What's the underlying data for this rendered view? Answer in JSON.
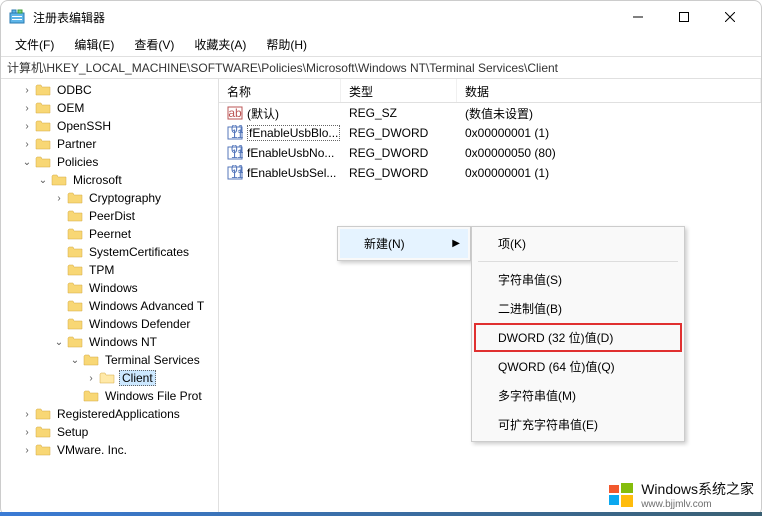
{
  "window": {
    "title": "注册表编辑器"
  },
  "menubar": {
    "items": [
      "文件(F)",
      "编辑(E)",
      "查看(V)",
      "收藏夹(A)",
      "帮助(H)"
    ]
  },
  "addressbar": {
    "path": "计算机\\HKEY_LOCAL_MACHINE\\SOFTWARE\\Policies\\Microsoft\\Windows NT\\Terminal Services\\Client"
  },
  "tree": {
    "items": [
      {
        "indent": 1,
        "expand": "right",
        "label": "ODBC"
      },
      {
        "indent": 1,
        "expand": "right",
        "label": "OEM"
      },
      {
        "indent": 1,
        "expand": "right",
        "label": "OpenSSH"
      },
      {
        "indent": 1,
        "expand": "right",
        "label": "Partner"
      },
      {
        "indent": 1,
        "expand": "down",
        "label": "Policies"
      },
      {
        "indent": 2,
        "expand": "down",
        "label": "Microsoft"
      },
      {
        "indent": 3,
        "expand": "right",
        "label": "Cryptography"
      },
      {
        "indent": 3,
        "expand": "none",
        "label": "PeerDist"
      },
      {
        "indent": 3,
        "expand": "none",
        "label": "Peernet"
      },
      {
        "indent": 3,
        "expand": "none",
        "label": "SystemCertificates"
      },
      {
        "indent": 3,
        "expand": "none",
        "label": "TPM"
      },
      {
        "indent": 3,
        "expand": "none",
        "label": "Windows"
      },
      {
        "indent": 3,
        "expand": "none",
        "label": "Windows Advanced T"
      },
      {
        "indent": 3,
        "expand": "none",
        "label": "Windows Defender"
      },
      {
        "indent": 3,
        "expand": "down",
        "label": "Windows NT"
      },
      {
        "indent": 4,
        "expand": "down",
        "label": "Terminal Services"
      },
      {
        "indent": 5,
        "expand": "right",
        "label": "Client",
        "selected": true
      },
      {
        "indent": 4,
        "expand": "none",
        "label": "Windows File Prot"
      },
      {
        "indent": 1,
        "expand": "right",
        "label": "RegisteredApplications"
      },
      {
        "indent": 1,
        "expand": "right",
        "label": "Setup"
      },
      {
        "indent": 1,
        "expand": "right",
        "label": "VMware. Inc."
      }
    ]
  },
  "list": {
    "columns": {
      "name": "名称",
      "type": "类型",
      "data": "数据"
    },
    "rows": [
      {
        "icon": "sz",
        "name": "(默认)",
        "type": "REG_SZ",
        "data": "(数值未设置)"
      },
      {
        "icon": "dw",
        "name": "fEnableUsbBlo...",
        "type": "REG_DWORD",
        "data": "0x00000001 (1)",
        "focused": true
      },
      {
        "icon": "dw",
        "name": "fEnableUsbNo...",
        "type": "REG_DWORD",
        "data": "0x00000050 (80)"
      },
      {
        "icon": "dw",
        "name": "fEnableUsbSel...",
        "type": "REG_DWORD",
        "data": "0x00000001 (1)"
      }
    ]
  },
  "context_main": {
    "items": [
      {
        "label": "新建(N)",
        "submenu": true
      }
    ]
  },
  "context_sub": {
    "items": [
      {
        "label": "项(K)"
      },
      {
        "sep": true
      },
      {
        "label": "字符串值(S)"
      },
      {
        "label": "二进制值(B)"
      },
      {
        "label": "DWORD (32 位)值(D)",
        "highlighted": true
      },
      {
        "label": "QWORD (64 位)值(Q)"
      },
      {
        "label": "多字符串值(M)"
      },
      {
        "label": "可扩充字符串值(E)"
      }
    ]
  },
  "watermark": {
    "main": "Windows系统之家",
    "url": "www.bjjmlv.com"
  }
}
